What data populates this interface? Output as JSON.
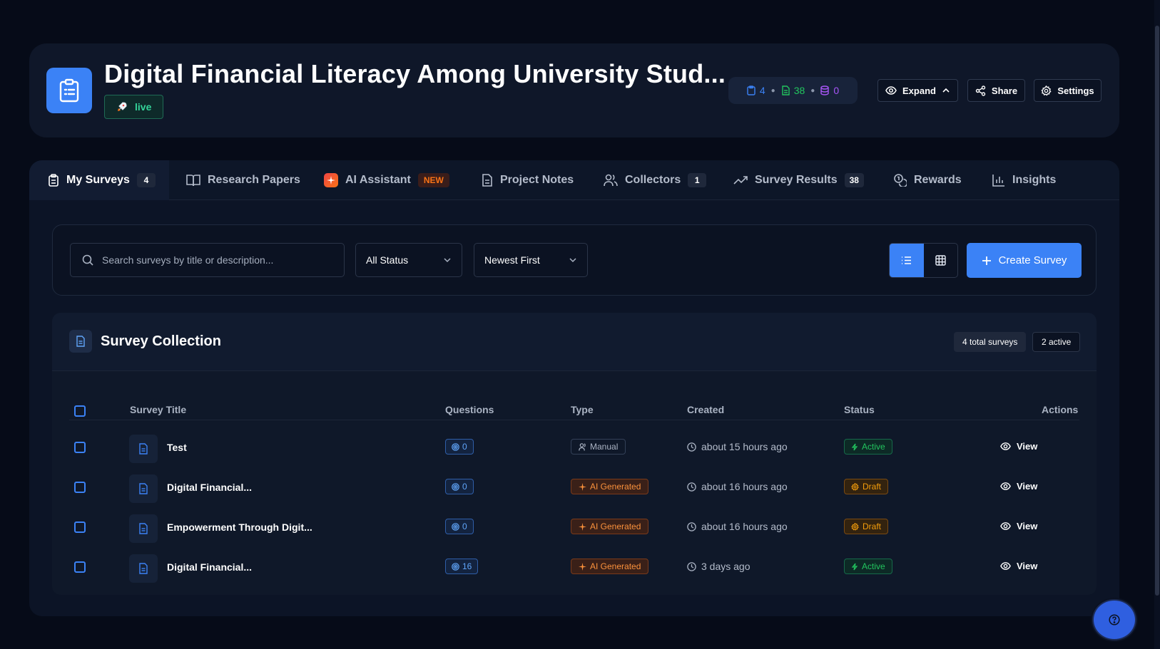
{
  "project": {
    "title": "Digital Financial Literacy Among University Stud...",
    "status_label": "live",
    "counts": {
      "surveys": "4",
      "responses": "38",
      "data": "0"
    }
  },
  "header_buttons": {
    "expand": "Expand",
    "share": "Share",
    "settings": "Settings"
  },
  "tabs": [
    {
      "label": "My Surveys",
      "count": "4"
    },
    {
      "label": "Research Papers"
    },
    {
      "label": "AI Assistant",
      "badge": "NEW"
    },
    {
      "label": "Project Notes"
    },
    {
      "label": "Collectors",
      "count": "1"
    },
    {
      "label": "Survey Results",
      "count": "38"
    },
    {
      "label": "Rewards"
    },
    {
      "label": "Insights"
    }
  ],
  "toolbar": {
    "search_placeholder": "Search surveys by title or description...",
    "status_filter": "All Status",
    "sort": "Newest First",
    "create_label": "Create Survey"
  },
  "collection": {
    "title": "Survey Collection",
    "total_label": "4 total surveys",
    "active_label": "2 active",
    "columns": {
      "title": "Survey Title",
      "questions": "Questions",
      "type": "Type",
      "created": "Created",
      "status": "Status",
      "actions": "Actions"
    },
    "rows": [
      {
        "title": "Test",
        "questions": "0",
        "type": "Manual",
        "created": "about 15 hours ago",
        "status": "Active",
        "action": "View"
      },
      {
        "title": "Digital Financial...",
        "questions": "0",
        "type": "AI Generated",
        "created": "about 16 hours ago",
        "status": "Draft",
        "action": "View"
      },
      {
        "title": "Empowerment Through Digit...",
        "questions": "0",
        "type": "AI Generated",
        "created": "about 16 hours ago",
        "status": "Draft",
        "action": "View"
      },
      {
        "title": "Digital Financial...",
        "questions": "16",
        "type": "AI Generated",
        "created": "3 days ago",
        "status": "Active",
        "action": "View"
      }
    ]
  },
  "colors": {
    "accent": "#3b82f6",
    "active": "#22c55e",
    "draft": "#f59e0b",
    "ai": "#fb923c",
    "live": "#34d399"
  }
}
